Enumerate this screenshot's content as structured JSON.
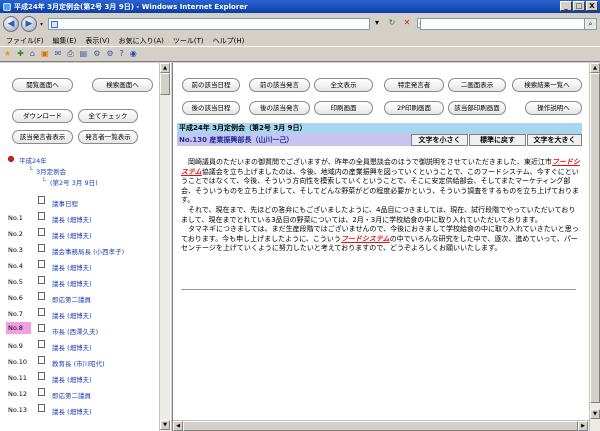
{
  "window": {
    "title": "平成24年 3月定例会(第2号 3月 9日) - Windows Internet Explorer",
    "minimize": "_",
    "maximize": "□",
    "close": "X"
  },
  "address": {
    "url": "",
    "search_placeholder": ""
  },
  "menu": {
    "items": [
      "ファイル(F)",
      "編集(E)",
      "表示(V)",
      "お気に入り(A)",
      "ツール(T)",
      "ヘルプ(H)"
    ]
  },
  "left": {
    "buttons": {
      "browse_screen": "閲覧画面へ",
      "search_screen": "検索画面へ",
      "download": "ダウンロード",
      "check_all": "全てチェック",
      "show_matching_speakers": "該当発言者表示",
      "show_speaker_list": "発言者一覧表示"
    },
    "tree": {
      "year": "平成24年",
      "session": "3月定例会",
      "issue": "(第2号 3月 9日)"
    },
    "speakers": [
      {
        "no": "",
        "name": "議事日程"
      },
      {
        "no": "No.1",
        "name": "議長 (畑博夫)"
      },
      {
        "no": "No.2",
        "name": "議長 (畑博夫)"
      },
      {
        "no": "No.3",
        "name": "議会事務局長 (小西孝子)"
      },
      {
        "no": "No.4",
        "name": "議長 (畑博夫)"
      },
      {
        "no": "No.5",
        "name": "議長 (畑博夫)"
      },
      {
        "no": "No.6",
        "name": "即応第二議員"
      },
      {
        "no": "No.7",
        "name": "議長 (畑博夫)"
      },
      {
        "no": "No.8",
        "name": "市長 (西澤久夫)"
      },
      {
        "no": "No.9",
        "name": "議長 (畑博夫)"
      },
      {
        "no": "No.10",
        "name": "教育長 (市川昭代)"
      },
      {
        "no": "No.11",
        "name": "議長 (畑博夫)"
      },
      {
        "no": "No.12",
        "name": "即応第二議員"
      },
      {
        "no": "No.13",
        "name": "議長 (畑博夫)"
      }
    ]
  },
  "right": {
    "buttons": {
      "prev_schedule": "前の該当日程",
      "prev_speech": "前の該当発言",
      "full_text": "全文表示",
      "specific_speaker": "特定発言者",
      "two_column": "二画面表示",
      "search_results": "検索結果一覧へ",
      "next_schedule": "後の該当日程",
      "next_speech": "後の該当発言",
      "print_screen": "印刷画面",
      "print_2p": "2P印刷画面",
      "print_matching": "該当部印刷画面",
      "help": "操作説明へ"
    },
    "header": "平成24年 3月定例会（第2号 3月 9日）",
    "speaker": "No.130 産業振興部長（山川一己）",
    "size_buttons": {
      "smaller": "文字を小さく",
      "standard": "標準に戻す",
      "larger": "文字を大きく"
    },
    "body": {
      "p1_a": "岡崎議員のただいまの御質問でございますが、昨年の全員懇談会のほうで御説明をさせていただきました、東近江市",
      "p1_hl": "フードシステム",
      "p1_b": "協議会を立ち上げましたのは、今後、地域内の産業振興を図っていくということで、このフードシステム、今すぐにということではなくて、今後、そういう方向性を模索していくということで、そこに安定供給部会、そしてまたマーケティング部会、そういうものを立ち上げまして、そしてどんな野菜がどの程度必要かという、そういう調査をするものを立ち上げております。",
      "p2": "それで、現在まで、先ほどの答弁にもございましたように、4品目につきましては、現在、試行段階でやっていただいておりまして、現在までとれている3品目の野菜については、2月・3月に学校給食の中に取り入れていただいております。",
      "p3_a": "タマネギにつきましては、まだ生産段階ではございませんので、今後におきまして学校給食の中に取り入れていきたいと思っております。今も申し上げましたように、こういう",
      "p3_hl": "フードシステム",
      "p3_b": "の中でいろんな研究をした中で、逐次、進めていって、パーセンテージを上げていくように努力したいと考えておりますので、どうぞよろしくお願いいたします。"
    }
  }
}
